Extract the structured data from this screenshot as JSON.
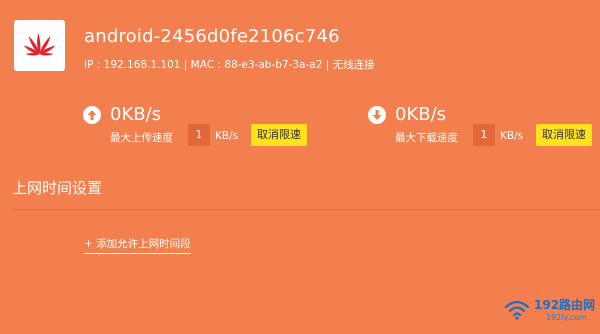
{
  "device": {
    "name": "android-2456d0fe2106c746",
    "info": "IP : 192.168.1.101 | MAC : 88-e3-ab-b7-3a-a2 | 无线连接"
  },
  "upload": {
    "icon": "arrow-up-icon",
    "value": "0KB/s",
    "limit_label": "最大上传速度",
    "limit_value": "1",
    "unit": "KB/s",
    "cancel_label": "取消限速"
  },
  "download": {
    "icon": "arrow-down-icon",
    "value": "0KB/s",
    "limit_label": "最大下载速度",
    "limit_value": "1",
    "unit": "KB/s",
    "cancel_label": "取消限速"
  },
  "schedule": {
    "title": "上网时间设置",
    "add_link": "+ 添加允许上网时间段"
  },
  "watermark": {
    "text": "192路由网",
    "sub": "192ly.com"
  },
  "colors": {
    "background": "#f37f4e",
    "button": "#ffe21c",
    "input": "#e1683a",
    "logo": "#e4222e"
  }
}
